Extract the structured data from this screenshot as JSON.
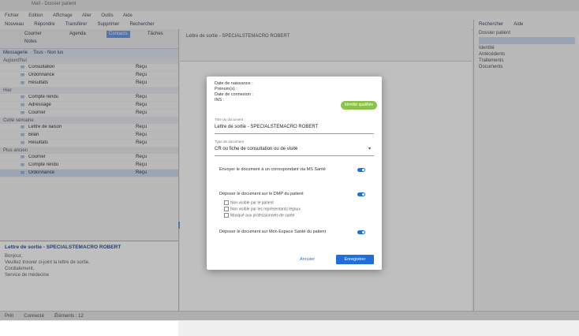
{
  "window": {
    "title": "Mail - Dossier patient"
  },
  "menubar": [
    "Fichier",
    "Edition",
    "Affichage",
    "Aller",
    "Outils",
    "Aide"
  ],
  "toolbar": {
    "items": [
      "Nouveau",
      "Répondre",
      "Transférer",
      "Supprimer",
      "Rechercher"
    ],
    "right_items": [
      "Rechercher",
      "Aide"
    ]
  },
  "left": {
    "tabs": [
      "Courrier",
      "Agenda",
      "Contacts",
      "Tâches",
      "Notes"
    ],
    "section_title": "Messagerie",
    "filter": "Tous - Non lus",
    "groups": [
      {
        "label": "Aujourd'hui",
        "rows": [
          {
            "icon": "✉",
            "label": "Consultation",
            "status": "Reçu"
          },
          {
            "icon": "✉",
            "label": "Ordonnance",
            "status": "Reçu"
          },
          {
            "icon": "✉",
            "label": "Résultats",
            "status": "Reçu"
          }
        ]
      },
      {
        "label": "Hier",
        "rows": [
          {
            "icon": "✉",
            "label": "Compte rendu",
            "status": "Reçu"
          },
          {
            "icon": "✉",
            "label": "Adressage",
            "status": "Reçu"
          },
          {
            "icon": "✉",
            "label": "Courrier",
            "status": "Reçu"
          }
        ]
      },
      {
        "label": "Cette semaine",
        "rows": [
          {
            "icon": "✉",
            "label": "Lettre de liaison",
            "status": "Reçu"
          },
          {
            "icon": "✉",
            "label": "Bilan",
            "status": "Reçu"
          },
          {
            "icon": "✉",
            "label": "Résultats",
            "status": "Reçu"
          }
        ]
      },
      {
        "label": "Plus ancien",
        "rows": [
          {
            "icon": "✉",
            "label": "Courrier",
            "status": "Reçu"
          },
          {
            "icon": "✉",
            "label": "Compte rendu",
            "status": "Reçu"
          },
          {
            "icon": "✉",
            "label": "Ordonnance",
            "status": "Reçu"
          }
        ]
      }
    ],
    "preview": {
      "title": "Lettre de sortie - SPECIALSTEMACRO ROBERT",
      "lines": [
        "Bonjour,",
        "Veuillez trouver ci-joint la lettre de sortie.",
        "Cordialement,",
        "Service de médecine"
      ]
    }
  },
  "main": {
    "subject": "Lettre de sortie - SPECIALSTEMACRO ROBERT"
  },
  "right": {
    "title": "Dossier patient",
    "lines": [
      "Identité",
      "Antécédents",
      "Traitements",
      "Documents"
    ]
  },
  "modal": {
    "meta": [
      {
        "key": "Date de naissance",
        "val": ""
      },
      {
        "key": "Prénom(s)",
        "val": ""
      },
      {
        "key": "Date de connexion",
        "val": ""
      },
      {
        "key": "INS",
        "val": ""
      }
    ],
    "badge": "Identité qualifiée",
    "title_label": "Titre du document",
    "title_value": "Lettre de sortie - SPECIALSTEMACRO ROBERT",
    "type_label": "Type de document",
    "type_value": "CR ou fiche de consultation ou de visite",
    "opt1": "Envoyer le document à un correspondant via MS Santé",
    "opt2": "Déposer le document sur le DMP du patient",
    "sub1": "Non visible par le patient",
    "sub2": "Non visible par les représentants légaux",
    "sub3": "Masqué aux professionnels de santé",
    "opt3": "Déposer le document sur Mon Espace Santé du patient",
    "cancel": "Annuler",
    "ok": "Enregistrer"
  },
  "statusbar": [
    "Prêt",
    "Connecté",
    "Éléments : 12"
  ],
  "colors": {
    "accent": "#1e6fd9",
    "badge": "#8bc34a",
    "tab_active": "#5b8ee6"
  }
}
